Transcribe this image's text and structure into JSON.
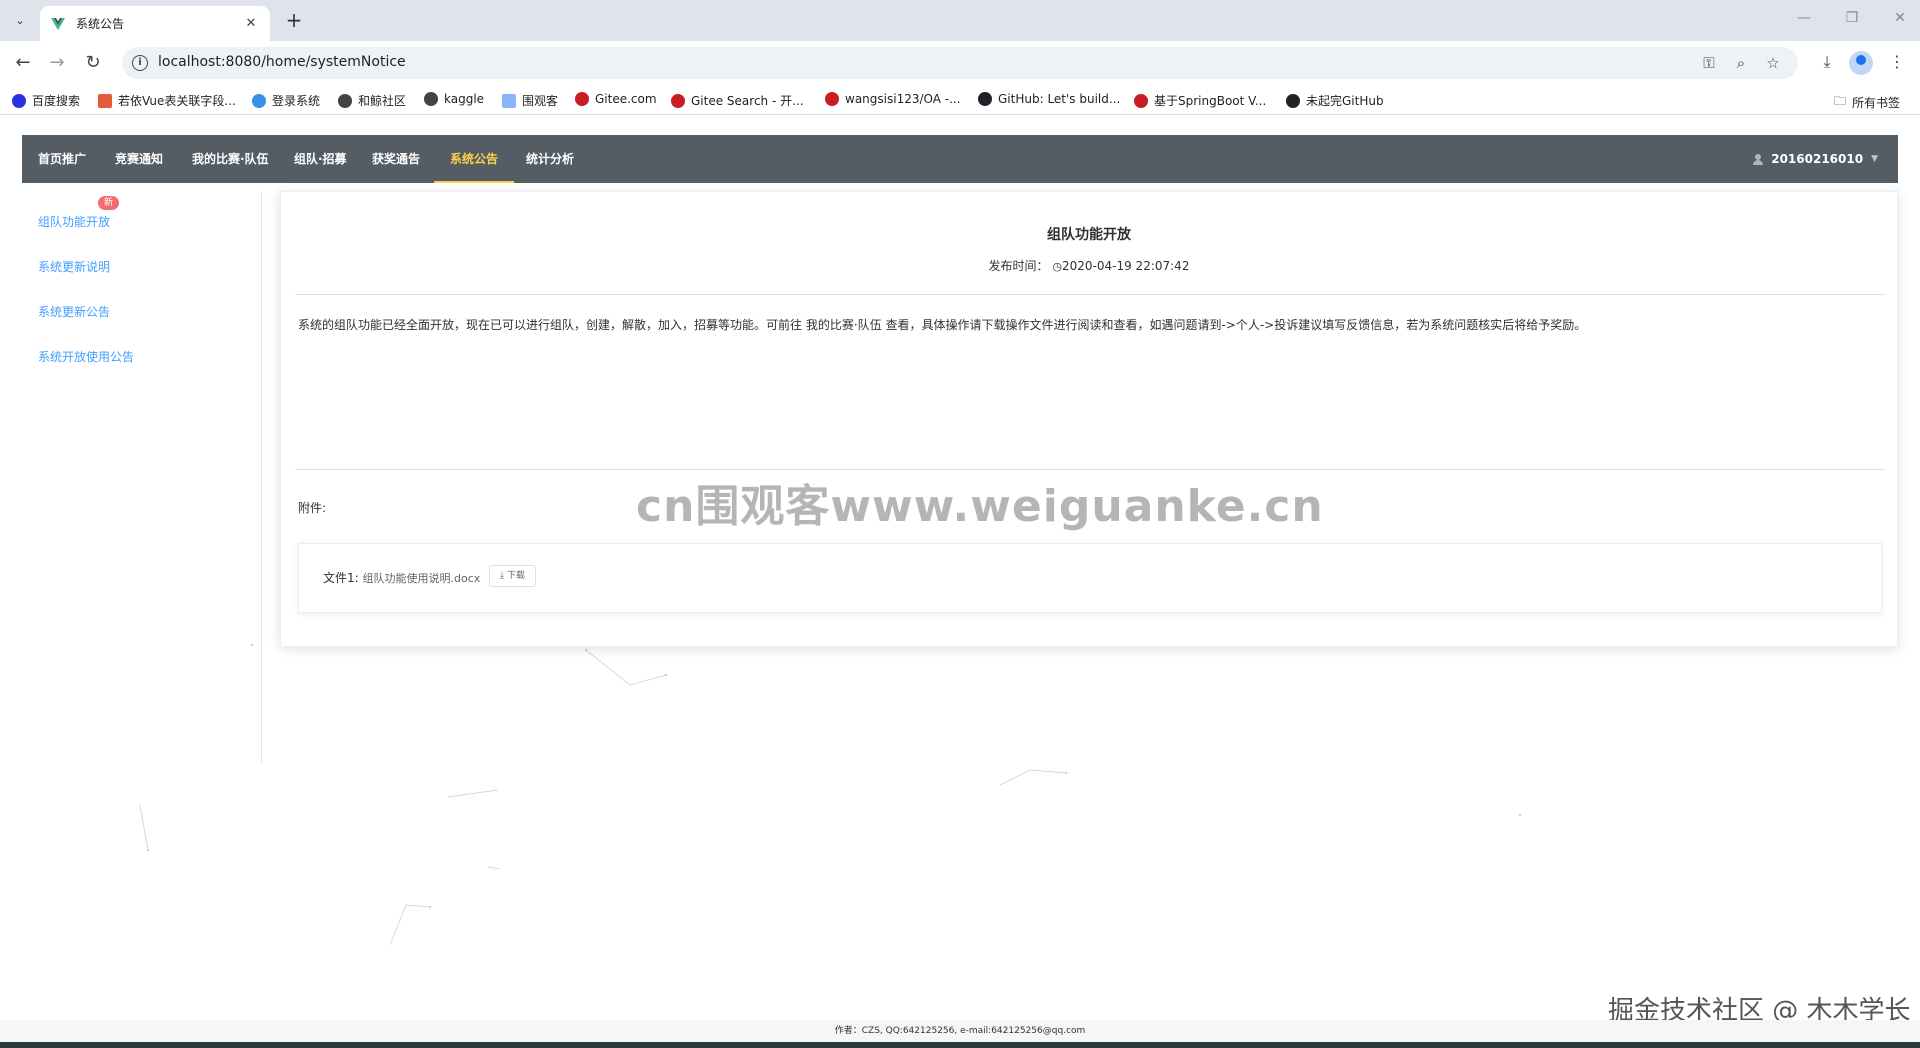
{
  "browser": {
    "tab_title": "系统公告",
    "url": "localhost:8080/home/systemNotice",
    "bookmarks": [
      {
        "label": "百度搜索",
        "color": "#2932e1"
      },
      {
        "label": "若依Vue表关联字段...",
        "color": "#e45b3c"
      },
      {
        "label": "登录系统",
        "color": "#3a8ee6"
      },
      {
        "label": "和鲸社区",
        "color": "#444444"
      },
      {
        "label": "kaggle",
        "color": "#444444"
      },
      {
        "label": "围观客",
        "color": "#8ab4f8"
      },
      {
        "label": "Gitee.com",
        "color": "#c71d23"
      },
      {
        "label": "Gitee Search - 开...",
        "color": "#c71d23"
      },
      {
        "label": "wangsisi123/OA -...",
        "color": "#c71d23"
      },
      {
        "label": "GitHub: Let's build...",
        "color": "#1f2328"
      },
      {
        "label": "基于SpringBoot V...",
        "color": "#c71d23"
      },
      {
        "label": "未起完GitHub",
        "color": "#1f2328"
      }
    ],
    "all_bookmarks": "所有书签"
  },
  "nav": {
    "items": [
      "首页推广",
      "竞赛通知",
      "我的比赛·队伍",
      "组队·招募",
      "获奖通告",
      "系统公告",
      "统计分析"
    ],
    "active_index": 5,
    "user": "20160216010"
  },
  "sidebar": {
    "badge": "新",
    "items": [
      "组队功能开放",
      "系统更新说明",
      "系统更新公告",
      "系统开放使用公告"
    ]
  },
  "notice": {
    "title": "组队功能开放",
    "time_label": "发布时间：",
    "time_value": "2020-04-19 22:07:42",
    "body": "系统的组队功能已经全面开放，现在已可以进行组队，创建，解散，加入，招募等功能。可前往 我的比赛·队伍 查看，具体操作请下载操作文件进行阅读和查看，如遇问题请到->个人->投诉建议填写反馈信息，若为系统问题核实后将给予奖励。",
    "attachment_label": "附件:",
    "file_label": "文件1:",
    "file_name": "组队功能使用说明.docx",
    "download_label": "下载"
  },
  "watermark": "cn围观客www.weiguanke.cn",
  "juejin_mark": "掘金技术社区 @ 木木学长",
  "footer": "作者：CZS, QQ:642125256, e-mail:642125256@qq.com",
  "colors": {
    "nav_bg": "#545c64",
    "nav_active": "#ffd04b",
    "link_blue": "#409eff",
    "badge_red": "#f56c6c"
  }
}
